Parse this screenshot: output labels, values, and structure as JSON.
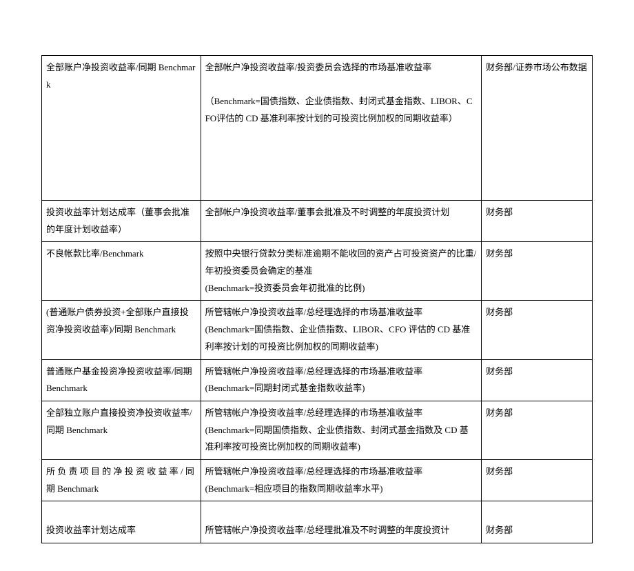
{
  "table": {
    "rows": [
      {
        "col1": "全部账户净投资收益率/同期 Benchmark",
        "col2a": "全部帐户净投资收益率/投资委员会选择的市场基准收益率",
        "col2b": "（Benchmark=国债指数、企业债指数、封闭式基金指数、LIBOR、CFO评估的 CD 基准利率按计划的可投资比例加权的同期收益率）",
        "col3": "财务部/证券市场公布数据",
        "tall": true
      },
      {
        "col1": "投资收益率计划达成率（董事会批准的年度计划收益率）",
        "col2": "全部帐户净投资收益率/董事会批准及不时调整的年度投资计划",
        "col3": "财务部"
      },
      {
        "col1": "不良帐款比率/Benchmark",
        "col2a": "按照中央银行贷款分类标准逾期不能收回的资产占可投资资产的比重/年初投资委员会确定的基准",
        "col2b": "(Benchmark=投资委员会年初批准的比例)",
        "col3": "财务部"
      },
      {
        "col1": "(普通账户债券投资+全部账户直接投资净投资收益率)/同期 Benchmark",
        "col2a": "所管辖帐户净投资收益率/总经理选择的市场基准收益率",
        "col2b": "(Benchmark=国债指数、企业债指数、LIBOR、CFO 评估的 CD 基准利率按计划的可投资比例加权的同期收益率)",
        "col3": "财务部"
      },
      {
        "col1": "普通账户基金投资净投资收益率/同期 Benchmark",
        "col2a": "所管辖帐户净投资收益率/总经理选择的市场基准收益率",
        "col2b": "(Benchmark=同期封闭式基金指数收益率)",
        "col3": "财务部"
      },
      {
        "col1": "全部独立账户直接投资净投资收益率/同期 Benchmark",
        "col2a": "所管辖帐户净投资收益率/总经理选择的市场基准收益率",
        "col2b": "(Benchmark=同期国债指数、企业债指数、封闭式基金指数及 CD 基准利率按可投资比例加权的同期收益率)",
        "col3": "财务部"
      },
      {
        "col1": "所 负 责 项 目 的 净 投 资 收 益 率 / 同 期 Benchmark",
        "col2a": "所管辖帐户净投资收益率/总经理选择的市场基准收益率",
        "col2b": "(Benchmark=相应项目的指数同期收益率水平)",
        "col3": "财务部"
      },
      {
        "col1": "投资收益率计划达成率",
        "col2": "所管辖帐户净投资收益率/总经理批准及不时调整的年度投资计",
        "col3": "财务部",
        "spacerBefore": true
      }
    ]
  }
}
